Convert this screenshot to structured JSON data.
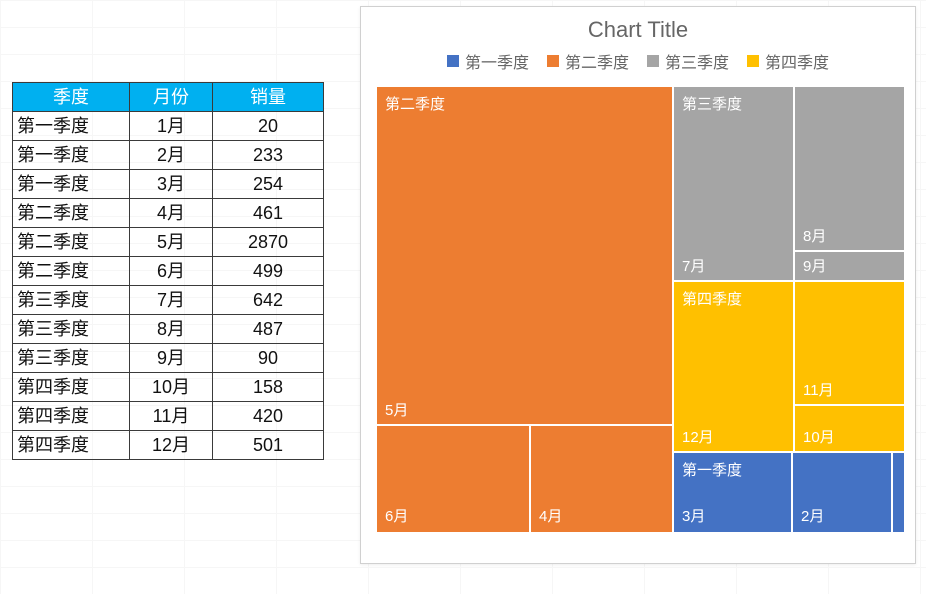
{
  "table": {
    "headers": {
      "quarter": "季度",
      "month": "月份",
      "sales": "销量"
    },
    "rows": [
      {
        "quarter": "第一季度",
        "month": "1月",
        "sales": "20"
      },
      {
        "quarter": "第一季度",
        "month": "2月",
        "sales": "233"
      },
      {
        "quarter": "第一季度",
        "month": "3月",
        "sales": "254"
      },
      {
        "quarter": "第二季度",
        "month": "4月",
        "sales": "461"
      },
      {
        "quarter": "第二季度",
        "month": "5月",
        "sales": "2870"
      },
      {
        "quarter": "第二季度",
        "month": "6月",
        "sales": "499"
      },
      {
        "quarter": "第三季度",
        "month": "7月",
        "sales": "642"
      },
      {
        "quarter": "第三季度",
        "month": "8月",
        "sales": "487"
      },
      {
        "quarter": "第三季度",
        "month": "9月",
        "sales": "90"
      },
      {
        "quarter": "第四季度",
        "month": "10月",
        "sales": "158"
      },
      {
        "quarter": "第四季度",
        "month": "11月",
        "sales": "420"
      },
      {
        "quarter": "第四季度",
        "month": "12月",
        "sales": "501"
      }
    ]
  },
  "chart": {
    "title": "Chart Title",
    "legend": {
      "q1": "第一季度",
      "q2": "第二季度",
      "q3": "第三季度",
      "q4": "第四季度"
    },
    "group_labels": {
      "q1": "第一季度",
      "q2": "第二季度",
      "q3": "第三季度",
      "q4": "第四季度"
    },
    "leaf_labels": {
      "m2": "2月",
      "m3": "3月",
      "m4": "4月",
      "m5": "5月",
      "m6": "6月",
      "m7": "7月",
      "m8": "8月",
      "m9": "9月",
      "m10": "10月",
      "m11": "11月",
      "m12": "12月"
    }
  },
  "colors": {
    "q1": "#4472c4",
    "q2": "#ed7d31",
    "q3": "#a5a5a5",
    "q4": "#ffc000",
    "header": "#00b0f0"
  },
  "chart_data": {
    "type": "treemap",
    "title": "Chart Title",
    "value_field": "销量",
    "series": [
      {
        "name": "第一季度",
        "color": "#4472c4",
        "items": [
          {
            "label": "1月",
            "value": 20
          },
          {
            "label": "2月",
            "value": 233
          },
          {
            "label": "3月",
            "value": 254
          }
        ]
      },
      {
        "name": "第二季度",
        "color": "#ed7d31",
        "items": [
          {
            "label": "4月",
            "value": 461
          },
          {
            "label": "5月",
            "value": 2870
          },
          {
            "label": "6月",
            "value": 499
          }
        ]
      },
      {
        "name": "第三季度",
        "color": "#a5a5a5",
        "items": [
          {
            "label": "7月",
            "value": 642
          },
          {
            "label": "8月",
            "value": 487
          },
          {
            "label": "9月",
            "value": 90
          }
        ]
      },
      {
        "name": "第四季度",
        "color": "#ffc000",
        "items": [
          {
            "label": "10月",
            "value": 158
          },
          {
            "label": "11月",
            "value": 420
          },
          {
            "label": "12月",
            "value": 501
          }
        ]
      }
    ]
  }
}
